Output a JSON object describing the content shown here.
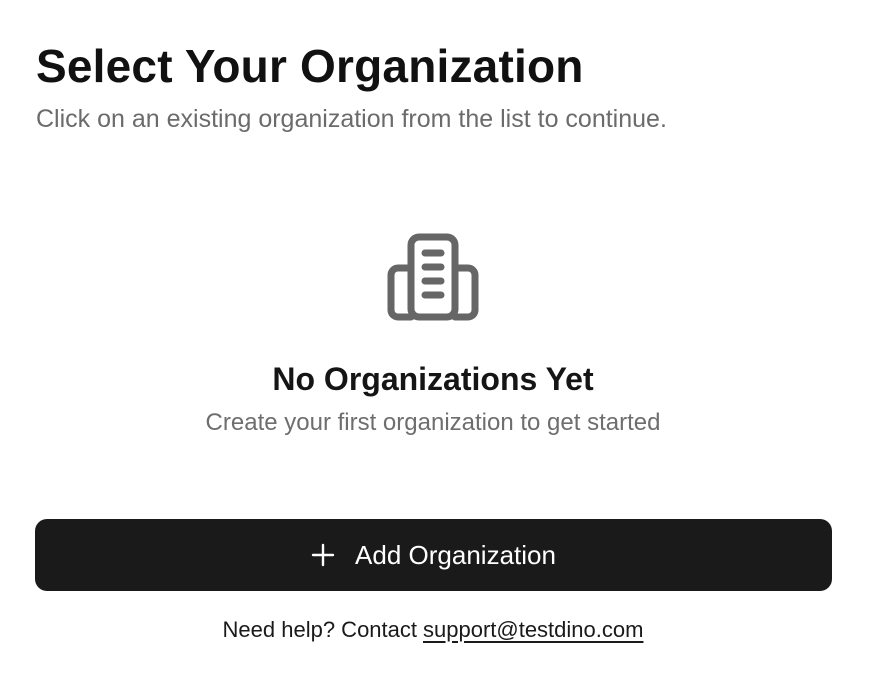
{
  "header": {
    "title": "Select Your Organization",
    "subtitle": "Click on an existing organization from the list to continue."
  },
  "empty_state": {
    "icon": "building-icon",
    "title": "No Organizations Yet",
    "subtitle": "Create your first organization to get started"
  },
  "actions": {
    "add_icon": "plus-icon",
    "add_label": "Add Organization"
  },
  "help": {
    "prefix": "Need help? Contact",
    "email": "support@testdino.com"
  },
  "colors": {
    "button_bg": "#1a1a1a",
    "title": "#111111",
    "muted_text": "#6b6b6b",
    "icon": "#666666"
  }
}
